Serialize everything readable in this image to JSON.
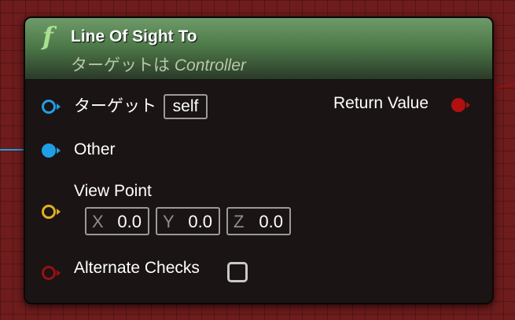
{
  "node": {
    "title": "Line Of Sight To",
    "subtitle_prefix": "ターゲットは",
    "subtitle_class": "Controller",
    "func_icon": "f"
  },
  "pins": {
    "target": {
      "label": "ターゲット",
      "default": "self"
    },
    "other": {
      "label": "Other"
    },
    "view_point": {
      "label": "View Point",
      "x": {
        "axis": "X",
        "value": "0.0"
      },
      "y": {
        "axis": "Y",
        "value": "0.0"
      },
      "z": {
        "axis": "Z",
        "value": "0.0"
      }
    },
    "alternate_checks": {
      "label": "Alternate Checks",
      "checked": false
    },
    "return_value": {
      "label": "Return Value"
    }
  },
  "colors": {
    "object_pin": "#1ea0e6",
    "vector_pin": "#e0b020",
    "bool_pin": "#9a1010",
    "header_green": "#4e7a4a",
    "graph_bg": "#6e1c1c"
  },
  "icons": [
    "function-icon",
    "object-pin-icon",
    "vector-pin-icon",
    "bool-pin-icon",
    "checkbox-icon"
  ]
}
